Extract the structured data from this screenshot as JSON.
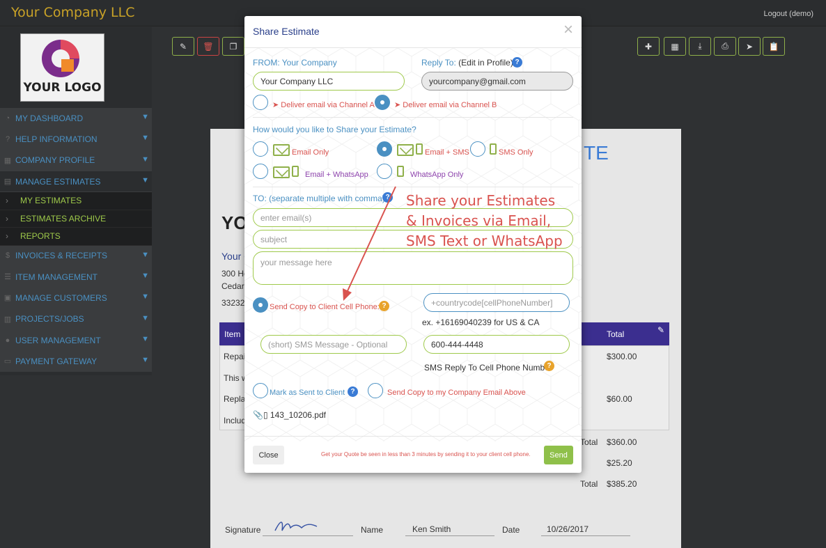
{
  "app": {
    "company": "Your Company LLC",
    "logout": "Logout (demo)",
    "logo_text": "YOUR LOGO"
  },
  "sidebar": {
    "items": [
      {
        "label": "MY DASHBOARD"
      },
      {
        "label": "HELP INFORMATION"
      },
      {
        "label": "COMPANY PROFILE"
      },
      {
        "label": "MANAGE ESTIMATES"
      }
    ],
    "subitems": [
      {
        "label": "MY ESTIMATES"
      },
      {
        "label": "ESTIMATES ARCHIVE"
      },
      {
        "label": "REPORTS"
      }
    ],
    "items2": [
      {
        "label": "INVOICES & RECEIPTS"
      },
      {
        "label": "ITEM MANAGEMENT"
      },
      {
        "label": "MANAGE CUSTOMERS"
      },
      {
        "label": "PROJECTS/JOBS"
      },
      {
        "label": "USER MANAGEMENT"
      },
      {
        "label": "PAYMENT GATEWAY"
      }
    ]
  },
  "document": {
    "title_fragment": "TE",
    "logo_fragment": "YO",
    "company_fragment": "Your C",
    "address1": "300 Ho",
    "address2": "Cedar I",
    "zip": "33232",
    "col_item": "Item",
    "col_total": "Total",
    "row1_item": "Repai",
    "row1_total": "$300.00",
    "row2_item": "This w",
    "row3_item": "Replac",
    "row3_total": "$60.00",
    "row4_item": "Includ",
    "subtotal_label": "Total",
    "subtotal_value": "$360.00",
    "tax_value": "$25.20",
    "grand_label": "Total",
    "grand_value": "$385.20",
    "signature_label": "Signature",
    "name_label": "Name",
    "name_value": "Ken Smith",
    "date_label": "Date",
    "date_value": "10/26/2017"
  },
  "modal": {
    "title": "Share Estimate",
    "close_glyph": "×",
    "from_label": "FROM: Your Company",
    "from_value": "Your Company LLC",
    "reply_label": "Reply To:",
    "reply_note": "(Edit in Profile)",
    "reply_value": "yourcompany@gmail.com",
    "channel_a": "Deliver email via Channel A",
    "channel_b": "Deliver email via Channel B",
    "share_question": "How would you like to Share your Estimate?",
    "opt_email_only": "Email Only",
    "opt_email_sms": "Email + SMS",
    "opt_sms_only": "SMS Only",
    "opt_email_whatsapp": "Email + WhatsApp",
    "opt_whatsapp_only": "WhatsApp Only",
    "to_label": "TO: (separate multiple with comma)",
    "email_placeholder": "enter email(s)",
    "subject_placeholder": "subject",
    "message_placeholder": "your message here",
    "send_copy_phone": "Send Copy to Client Cell Phone:",
    "phone_placeholder": "+countrycode[cellPhoneNumber]",
    "phone_example": "ex. +16169040239 for US & CA",
    "sms_placeholder": "(short) SMS Message - Optional",
    "reply_phone": "600-444-4448",
    "sms_reply_label": "SMS Reply To Cell Phone Number",
    "mark_sent": "Mark as Sent to Client",
    "send_copy_company": "Send Copy to my Company Email Above",
    "attachment": "143_10206.pdf",
    "close_button": "Close",
    "footer_note": "Get your Quote be seen in less than 3 minutes by sending it to your client cell phone.",
    "send_button": "Send"
  },
  "annotation": {
    "line1": "Share  your Estimates",
    "line2": "& Invoices via Email,",
    "line3": "SMS Text or WhatsApp"
  },
  "colors": {
    "accent_blue": "#4a90c2",
    "accent_green": "#8fb04a",
    "accent_red": "#d9534f",
    "brand_gold": "#c9a227",
    "table_header": "#3b2e8f"
  }
}
